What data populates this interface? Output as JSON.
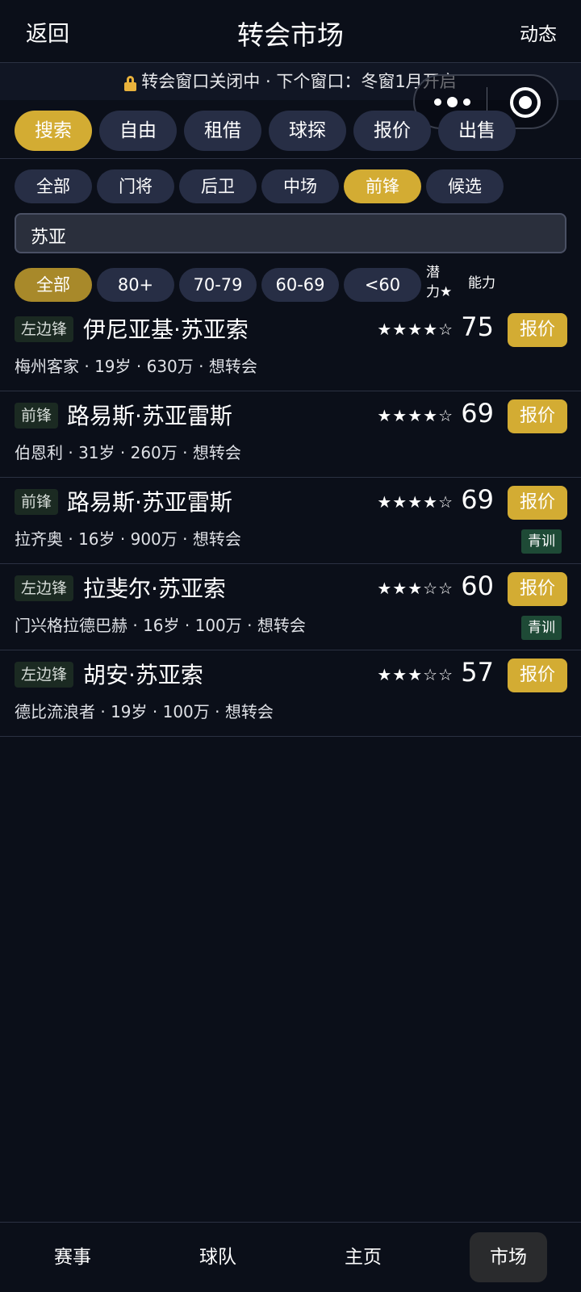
{
  "header": {
    "back": "返回",
    "title": "转会市场",
    "news": "动态"
  },
  "notice": "转会窗口关闭中 · 下个窗口：冬窗1月开启",
  "tabs": [
    "搜索",
    "自由",
    "租借",
    "球探",
    "报价",
    "出售"
  ],
  "active_tab": "搜索",
  "positions": [
    "全部",
    "门将",
    "后卫",
    "中场",
    "前锋",
    "候选"
  ],
  "active_position": "前锋",
  "search": {
    "value": "苏亚"
  },
  "ranges": [
    "全部",
    "80+",
    "70-79",
    "60-69",
    "<60"
  ],
  "active_range": "全部",
  "sort": {
    "potential": "潜力★",
    "potential_line1": "潜",
    "potential_line2": "力★",
    "ability": "能力"
  },
  "players": [
    {
      "position": "左边锋",
      "name": "伊尼亚基·苏亚索",
      "stars": "★★★★☆",
      "rating": "75",
      "offer": "报价",
      "meta": "梅州客家 · 19岁 · 630万 · 想转会",
      "youth": ""
    },
    {
      "position": "前锋",
      "name": "路易斯·苏亚雷斯",
      "stars": "★★★★☆",
      "rating": "69",
      "offer": "报价",
      "meta": "伯恩利 · 31岁 · 260万 · 想转会",
      "youth": ""
    },
    {
      "position": "前锋",
      "name": "路易斯·苏亚雷斯",
      "stars": "★★★★☆",
      "rating": "69",
      "offer": "报价",
      "meta": "拉齐奥 · 16岁 · 900万 · 想转会",
      "youth": "青训"
    },
    {
      "position": "左边锋",
      "name": "拉斐尔·苏亚索",
      "stars": "★★★☆☆",
      "rating": "60",
      "offer": "报价",
      "meta": "门兴格拉德巴赫 · 16岁 · 100万 · 想转会",
      "youth": "青训"
    },
    {
      "position": "左边锋",
      "name": "胡安·苏亚索",
      "stars": "★★★☆☆",
      "rating": "57",
      "offer": "报价",
      "meta": "德比流浪者 · 19岁 · 100万 · 想转会",
      "youth": ""
    }
  ],
  "bottom_nav": [
    "赛事",
    "球队",
    "主页",
    "市场"
  ],
  "active_nav": "市场",
  "colors": {
    "background": "#0b0f19",
    "accent": "#d3ac33",
    "pill": "#272e45",
    "youth_badge": "#1e4a36"
  }
}
